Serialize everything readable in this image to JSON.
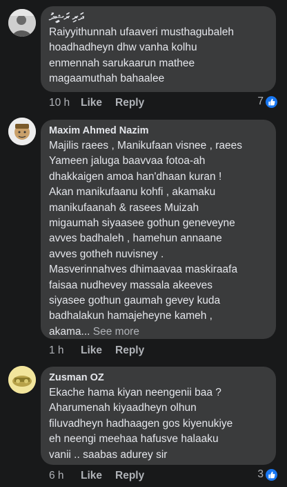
{
  "comments": [
    {
      "author": "ދަރި ރަޝީދު",
      "text": "Raiyyithunnah ufaaveri musthagubaleh\nhoadhadheyn dhw vanha kolhu\nenmennah sarukaarun mathee\nmagaamuthah bahaalee",
      "time": "10 h",
      "like": "Like",
      "reply": "Reply",
      "reaction_count": "7"
    },
    {
      "author": "Maxim Ahmed Nazim",
      "text": "Majilis raees , Manikufaan visnee , raees\nYameen jaluga baavvaa fotoa-ah\ndhakkaigen amoa han'dhaan kuran !\nAkan manikufaanu kohfi , akamaku\nmanikufaanah & rasees Muizah\nmigaumah siyaasee gothun geneveyne\navves badhaleh , hamehun annaane\navves gotheh nuvisney .\nMasverinnahves dhimaavaa maskiraafa\nfaisaa nudhevey massala akeeves\nsiyasee gothun gaumah gevey kuda\nbadhalakun hamajeheyne kameh ,\nakama...",
      "see_more": "See more",
      "time": "1 h",
      "like": "Like",
      "reply": "Reply"
    },
    {
      "author": "Zusman OZ",
      "text": "Ekache hama kiyan neengenii baa ?\nAharumenah kiyaadheyn olhun\nfiluvadheyn hadhaagen gos kiyenukiye\neh neengi meehaa hafusve halaaku\nvanii .. saabas adurey sir",
      "time": "6 h",
      "like": "Like",
      "reply": "Reply",
      "reaction_count": "3"
    }
  ],
  "colors": {
    "background": "#18191a",
    "bubble": "#3a3b3c",
    "primary_text": "#e4e6eb",
    "secondary_text": "#b0b3b8",
    "like_blue": "#1877f2"
  },
  "icons": {
    "reaction": "like-thumbs-up-icon"
  }
}
